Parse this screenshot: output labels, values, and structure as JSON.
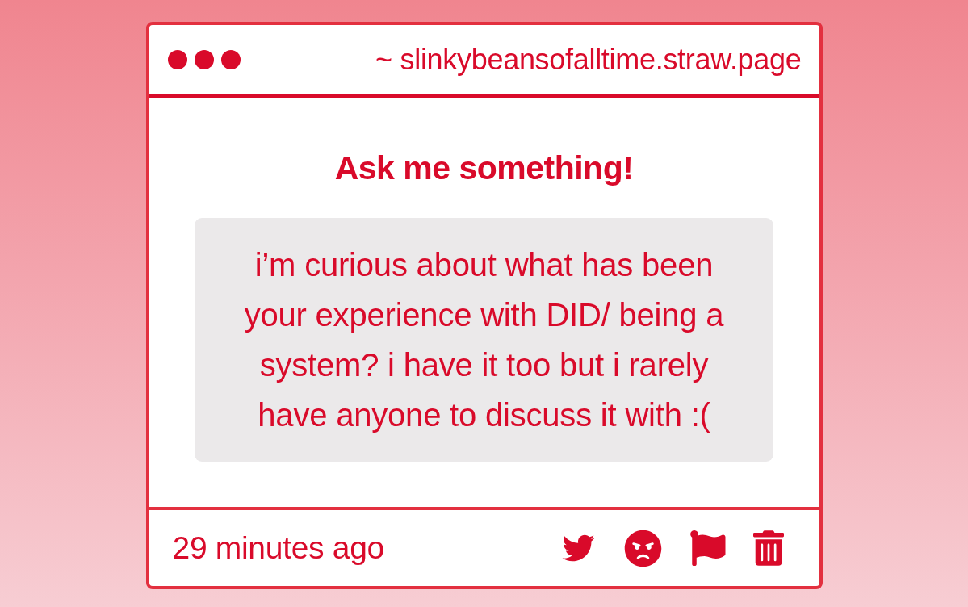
{
  "window": {
    "url": "~ slinkybeansofalltime.straw.page"
  },
  "prompt": {
    "title": "Ask me something!"
  },
  "question": {
    "text": "i’m curious about what has been your experience with DID/ being a system? i have it too but i rarely have anyone to discuss it with :("
  },
  "footer": {
    "time": "29 minutes ago",
    "actions": [
      {
        "kind": "tweet"
      },
      {
        "kind": "block"
      },
      {
        "kind": "report"
      },
      {
        "kind": "delete"
      }
    ]
  }
}
